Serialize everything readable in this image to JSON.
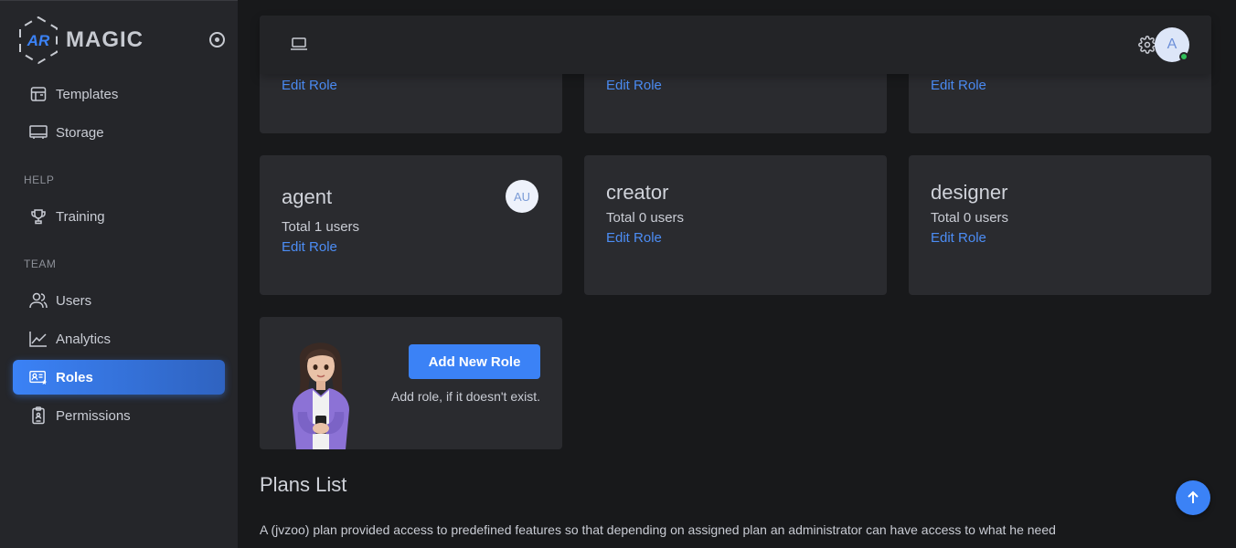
{
  "brand": {
    "name": "MAGIC",
    "logo_text": "AR"
  },
  "sidebar": {
    "items_top": [
      {
        "label": "Templates",
        "icon": "template-icon"
      },
      {
        "label": "Storage",
        "icon": "storage-icon"
      }
    ],
    "help_label": "HELP",
    "help_items": [
      {
        "label": "Training",
        "icon": "trophy-icon"
      }
    ],
    "team_label": "TEAM",
    "team_items": [
      {
        "label": "Users",
        "icon": "users-icon"
      },
      {
        "label": "Analytics",
        "icon": "analytics-icon"
      },
      {
        "label": "Roles",
        "icon": "roles-icon",
        "active": true
      },
      {
        "label": "Permissions",
        "icon": "permissions-icon"
      }
    ]
  },
  "header": {
    "avatar_initial": "A"
  },
  "roles_top": [
    {
      "edit": "Edit Role"
    },
    {
      "edit": "Edit Role"
    },
    {
      "edit": "Edit Role"
    }
  ],
  "roles": [
    {
      "name": "agent",
      "total": "Total 1 users",
      "edit": "Edit Role",
      "badge": "AU"
    },
    {
      "name": "creator",
      "total": "Total 0 users",
      "edit": "Edit Role"
    },
    {
      "name": "designer",
      "total": "Total 0 users",
      "edit": "Edit Role"
    }
  ],
  "add_role": {
    "button_label": "Add New Role",
    "note": "Add role, if it doesn't exist."
  },
  "plans": {
    "title": "Plans List",
    "description": "A (jvzoo) plan provided access to predefined features so that depending on assigned plan an administrator can have access to what he need"
  },
  "colors": {
    "accent": "#3b82f6",
    "link": "#4c8df5",
    "online": "#2fbf5a"
  }
}
